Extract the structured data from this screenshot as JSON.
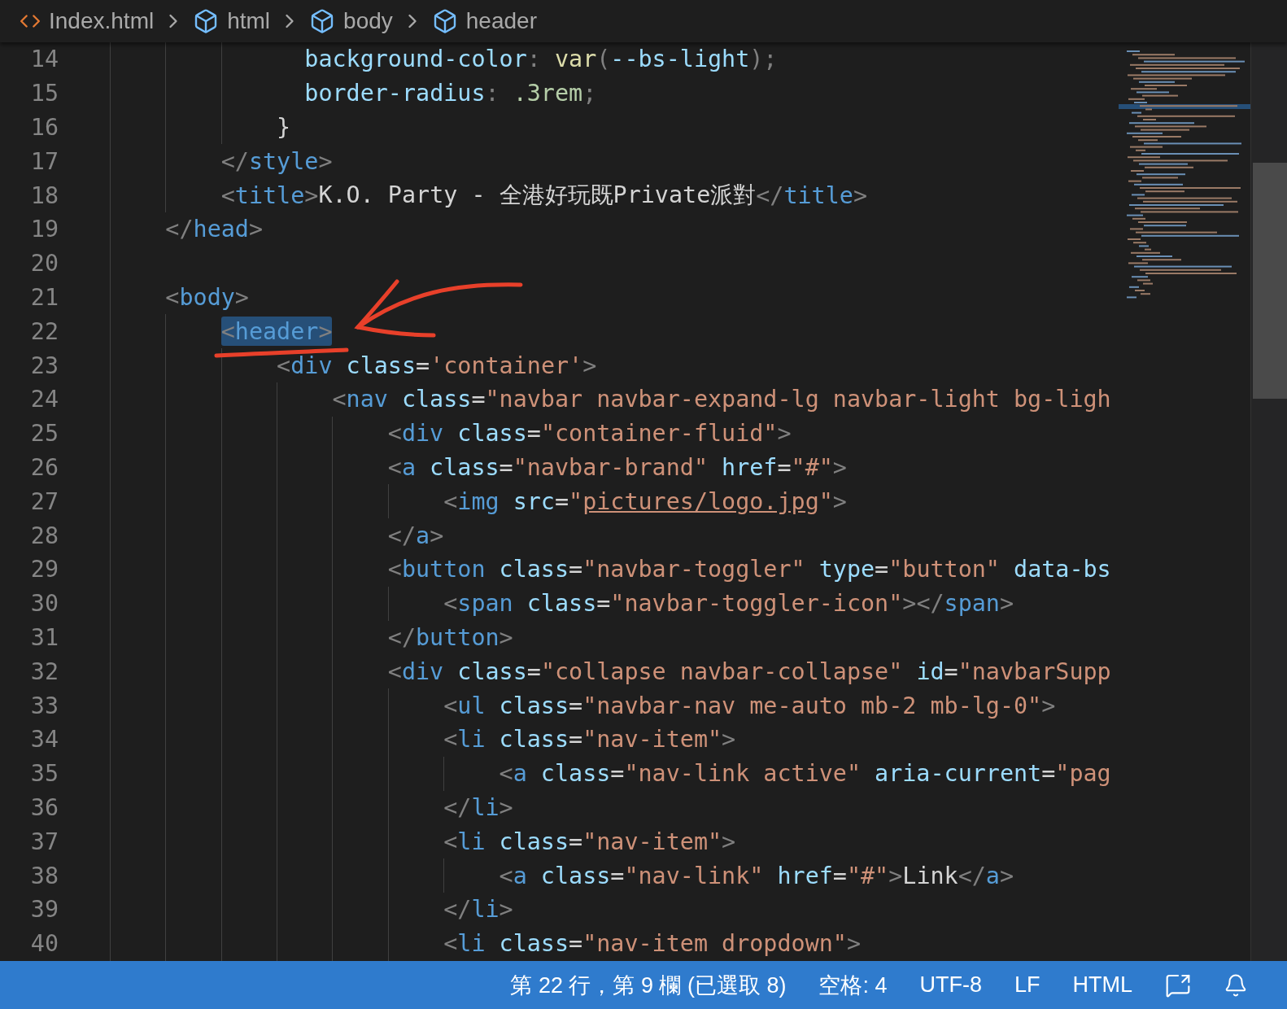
{
  "breadcrumb": [
    {
      "label": "Index.html",
      "kind": "file"
    },
    {
      "label": "html",
      "kind": "element"
    },
    {
      "label": "body",
      "kind": "element"
    },
    {
      "label": "header",
      "kind": "element"
    }
  ],
  "editor": {
    "lines": [
      {
        "children": [
          {
            "children": [
              {
                "children": [
                  {
                    "number": "14",
                    "selected": false,
                    "tokens": [
                      {
                        "kind": "attr",
                        "text": "  background-color"
                      },
                      {
                        "kind": "punct",
                        "text": ": "
                      },
                      {
                        "kind": "func",
                        "text": "var"
                      },
                      {
                        "kind": "punct",
                        "text": "("
                      },
                      {
                        "kind": "attr",
                        "text": "--bs-light"
                      },
                      {
                        "kind": "punct",
                        "text": ");"
                      }
                    ]
                  },
                  {
                    "number": "15",
                    "selected": false,
                    "tokens": [
                      {
                        "kind": "attr",
                        "text": "  border-radius"
                      },
                      {
                        "kind": "punct",
                        "text": ": "
                      },
                      {
                        "kind": "num",
                        "text": ".3rem"
                      },
                      {
                        "kind": "punct",
                        "text": ";"
                      }
                    ]
                  },
                  {
                    "number": "16",
                    "selected": false,
                    "tokens": [
                      {
                        "kind": "text",
                        "text": "}"
                      }
                    ]
                  }
                ]
              },
              {
                "number": "17",
                "selected": false,
                "tokens": [
                  {
                    "kind": "punct",
                    "text": "</"
                  },
                  {
                    "kind": "tag",
                    "text": "style"
                  },
                  {
                    "kind": "punct",
                    "text": ">"
                  }
                ]
              },
              {
                "number": "18",
                "selected": false,
                "tokens": [
                  {
                    "kind": "punct",
                    "text": "<"
                  },
                  {
                    "kind": "tag",
                    "text": "title"
                  },
                  {
                    "kind": "punct",
                    "text": ">"
                  },
                  {
                    "kind": "text",
                    "text": "K.O. Party - 全港好玩既Private派對"
                  },
                  {
                    "kind": "punct",
                    "text": "</"
                  },
                  {
                    "kind": "tag",
                    "text": "title"
                  },
                  {
                    "kind": "punct",
                    "text": ">"
                  }
                ]
              }
            ]
          },
          {
            "number": "19",
            "selected": false,
            "tokens": [
              {
                "kind": "punct",
                "text": "</"
              },
              {
                "kind": "tag",
                "text": "head"
              },
              {
                "kind": "punct",
                "text": ">"
              }
            ]
          },
          {
            "number": "20"
          },
          {
            "number": "21",
            "selected": false,
            "tokens": [
              {
                "kind": "punct",
                "text": "<"
              },
              {
                "kind": "tag",
                "text": "body"
              },
              {
                "kind": "punct",
                "text": ">"
              }
            ],
            "children": [
              {
                "number": "22",
                "selected": true,
                "tokens": [
                  {
                    "kind": "punct",
                    "text": "<"
                  },
                  {
                    "kind": "tag",
                    "text": "header"
                  },
                  {
                    "kind": "punct",
                    "text": ">"
                  }
                ],
                "children": [
                  {
                    "number": "23",
                    "selected": false,
                    "tokens": [
                      {
                        "kind": "punct",
                        "text": "<"
                      },
                      {
                        "kind": "tag",
                        "text": "div"
                      },
                      {
                        "kind": "attr",
                        "text": " class"
                      },
                      {
                        "kind": "text",
                        "text": "="
                      },
                      {
                        "kind": "string",
                        "text": "'container'"
                      },
                      {
                        "kind": "punct",
                        "text": ">"
                      }
                    ],
                    "children": [
                      {
                        "number": "24",
                        "selected": false,
                        "tokens": [
                          {
                            "kind": "punct",
                            "text": "<"
                          },
                          {
                            "kind": "tag",
                            "text": "nav"
                          },
                          {
                            "kind": "attr",
                            "text": " class"
                          },
                          {
                            "kind": "text",
                            "text": "="
                          },
                          {
                            "kind": "string",
                            "text": "\"navbar navbar-expand-lg navbar-light bg-ligh"
                          }
                        ],
                        "children": [
                          {
                            "number": "25",
                            "selected": false,
                            "tokens": [
                              {
                                "kind": "punct",
                                "text": "<"
                              },
                              {
                                "kind": "tag",
                                "text": "div"
                              },
                              {
                                "kind": "attr",
                                "text": " class"
                              },
                              {
                                "kind": "text",
                                "text": "="
                              },
                              {
                                "kind": "string",
                                "text": "\"container-fluid\""
                              },
                              {
                                "kind": "punct",
                                "text": ">"
                              }
                            ]
                          },
                          {
                            "number": "26",
                            "selected": false,
                            "tokens": [
                              {
                                "kind": "punct",
                                "text": "<"
                              },
                              {
                                "kind": "tag",
                                "text": "a"
                              },
                              {
                                "kind": "attr",
                                "text": " class"
                              },
                              {
                                "kind": "text",
                                "text": "="
                              },
                              {
                                "kind": "string",
                                "text": "\"navbar-brand\""
                              },
                              {
                                "kind": "attr",
                                "text": " href"
                              },
                              {
                                "kind": "text",
                                "text": "="
                              },
                              {
                                "kind": "string",
                                "text": "\"#\""
                              },
                              {
                                "kind": "punct",
                                "text": ">"
                              }
                            ],
                            "children": [
                              {
                                "number": "27",
                                "selected": false,
                                "tokens": [
                                  {
                                    "kind": "punct",
                                    "text": "<"
                                  },
                                  {
                                    "kind": "tag",
                                    "text": "img"
                                  },
                                  {
                                    "kind": "attr",
                                    "text": " src"
                                  },
                                  {
                                    "kind": "text",
                                    "text": "="
                                  },
                                  {
                                    "kind": "string",
                                    "text": "\""
                                  },
                                  {
                                    "kind": "link",
                                    "text": "pictures/logo.jpg"
                                  },
                                  {
                                    "kind": "string",
                                    "text": "\""
                                  },
                                  {
                                    "kind": "punct",
                                    "text": ">"
                                  }
                                ]
                              }
                            ]
                          },
                          {
                            "number": "28",
                            "selected": false,
                            "tokens": [
                              {
                                "kind": "punct",
                                "text": "</"
                              },
                              {
                                "kind": "tag",
                                "text": "a"
                              },
                              {
                                "kind": "punct",
                                "text": ">"
                              }
                            ]
                          },
                          {
                            "number": "29",
                            "selected": false,
                            "tokens": [
                              {
                                "kind": "punct",
                                "text": "<"
                              },
                              {
                                "kind": "tag",
                                "text": "button"
                              },
                              {
                                "kind": "attr",
                                "text": " class"
                              },
                              {
                                "kind": "text",
                                "text": "="
                              },
                              {
                                "kind": "string",
                                "text": "\"navbar-toggler\""
                              },
                              {
                                "kind": "attr",
                                "text": " type"
                              },
                              {
                                "kind": "text",
                                "text": "="
                              },
                              {
                                "kind": "string",
                                "text": "\"button\""
                              },
                              {
                                "kind": "attr",
                                "text": " data-bs"
                              }
                            ],
                            "children": [
                              {
                                "number": "30",
                                "selected": false,
                                "tokens": [
                                  {
                                    "kind": "punct",
                                    "text": "<"
                                  },
                                  {
                                    "kind": "tag",
                                    "text": "span"
                                  },
                                  {
                                    "kind": "attr",
                                    "text": " class"
                                  },
                                  {
                                    "kind": "text",
                                    "text": "="
                                  },
                                  {
                                    "kind": "string",
                                    "text": "\"navbar-toggler-icon\""
                                  },
                                  {
                                    "kind": "punct",
                                    "text": "></"
                                  },
                                  {
                                    "kind": "tag",
                                    "text": "span"
                                  },
                                  {
                                    "kind": "punct",
                                    "text": ">"
                                  }
                                ]
                              }
                            ]
                          },
                          {
                            "number": "31",
                            "selected": false,
                            "tokens": [
                              {
                                "kind": "punct",
                                "text": "</"
                              },
                              {
                                "kind": "tag",
                                "text": "button"
                              },
                              {
                                "kind": "punct",
                                "text": ">"
                              }
                            ]
                          },
                          {
                            "number": "32",
                            "selected": false,
                            "tokens": [
                              {
                                "kind": "punct",
                                "text": "<"
                              },
                              {
                                "kind": "tag",
                                "text": "div"
                              },
                              {
                                "kind": "attr",
                                "text": " class"
                              },
                              {
                                "kind": "text",
                                "text": "="
                              },
                              {
                                "kind": "string",
                                "text": "\"collapse navbar-collapse\""
                              },
                              {
                                "kind": "attr",
                                "text": " id"
                              },
                              {
                                "kind": "text",
                                "text": "="
                              },
                              {
                                "kind": "string",
                                "text": "\"navbarSupp"
                              }
                            ],
                            "children": [
                              {
                                "number": "33",
                                "selected": false,
                                "tokens": [
                                  {
                                    "kind": "punct",
                                    "text": "<"
                                  },
                                  {
                                    "kind": "tag",
                                    "text": "ul"
                                  },
                                  {
                                    "kind": "attr",
                                    "text": " class"
                                  },
                                  {
                                    "kind": "text",
                                    "text": "="
                                  },
                                  {
                                    "kind": "string",
                                    "text": "\"navbar-nav me-auto mb-2 mb-lg-0\""
                                  },
                                  {
                                    "kind": "punct",
                                    "text": ">"
                                  }
                                ]
                              },
                              {
                                "number": "34",
                                "selected": false,
                                "tokens": [
                                  {
                                    "kind": "punct",
                                    "text": "<"
                                  },
                                  {
                                    "kind": "tag",
                                    "text": "li"
                                  },
                                  {
                                    "kind": "attr",
                                    "text": " class"
                                  },
                                  {
                                    "kind": "text",
                                    "text": "="
                                  },
                                  {
                                    "kind": "string",
                                    "text": "\"nav-item\""
                                  },
                                  {
                                    "kind": "punct",
                                    "text": ">"
                                  }
                                ],
                                "children": [
                                  {
                                    "number": "35",
                                    "selected": false,
                                    "tokens": [
                                      {
                                        "kind": "punct",
                                        "text": "<"
                                      },
                                      {
                                        "kind": "tag",
                                        "text": "a"
                                      },
                                      {
                                        "kind": "attr",
                                        "text": " class"
                                      },
                                      {
                                        "kind": "text",
                                        "text": "="
                                      },
                                      {
                                        "kind": "string",
                                        "text": "\"nav-link active\""
                                      },
                                      {
                                        "kind": "attr",
                                        "text": " aria-current"
                                      },
                                      {
                                        "kind": "text",
                                        "text": "="
                                      },
                                      {
                                        "kind": "string",
                                        "text": "\"pag"
                                      }
                                    ]
                                  }
                                ]
                              },
                              {
                                "number": "36",
                                "selected": false,
                                "tokens": [
                                  {
                                    "kind": "punct",
                                    "text": "</"
                                  },
                                  {
                                    "kind": "tag",
                                    "text": "li"
                                  },
                                  {
                                    "kind": "punct",
                                    "text": ">"
                                  }
                                ]
                              },
                              {
                                "number": "37",
                                "selected": false,
                                "tokens": [
                                  {
                                    "kind": "punct",
                                    "text": "<"
                                  },
                                  {
                                    "kind": "tag",
                                    "text": "li"
                                  },
                                  {
                                    "kind": "attr",
                                    "text": " class"
                                  },
                                  {
                                    "kind": "text",
                                    "text": "="
                                  },
                                  {
                                    "kind": "string",
                                    "text": "\"nav-item\""
                                  },
                                  {
                                    "kind": "punct",
                                    "text": ">"
                                  }
                                ],
                                "children": [
                                  {
                                    "number": "38",
                                    "selected": false,
                                    "tokens": [
                                      {
                                        "kind": "punct",
                                        "text": "<"
                                      },
                                      {
                                        "kind": "tag",
                                        "text": "a"
                                      },
                                      {
                                        "kind": "attr",
                                        "text": " class"
                                      },
                                      {
                                        "kind": "text",
                                        "text": "="
                                      },
                                      {
                                        "kind": "string",
                                        "text": "\"nav-link\""
                                      },
                                      {
                                        "kind": "attr",
                                        "text": " href"
                                      },
                                      {
                                        "kind": "text",
                                        "text": "="
                                      },
                                      {
                                        "kind": "string",
                                        "text": "\"#\""
                                      },
                                      {
                                        "kind": "punct",
                                        "text": ">"
                                      },
                                      {
                                        "kind": "text",
                                        "text": "Link"
                                      },
                                      {
                                        "kind": "punct",
                                        "text": "</"
                                      },
                                      {
                                        "kind": "tag",
                                        "text": "a"
                                      },
                                      {
                                        "kind": "punct",
                                        "text": ">"
                                      }
                                    ]
                                  }
                                ]
                              },
                              {
                                "number": "39",
                                "selected": false,
                                "tokens": [
                                  {
                                    "kind": "punct",
                                    "text": "</"
                                  },
                                  {
                                    "kind": "tag",
                                    "text": "li"
                                  },
                                  {
                                    "kind": "punct",
                                    "text": ">"
                                  }
                                ]
                              },
                              {
                                "number": "40",
                                "selected": false,
                                "tokens": [
                                  {
                                    "kind": "punct",
                                    "text": "<"
                                  },
                                  {
                                    "kind": "tag",
                                    "text": "li"
                                  },
                                  {
                                    "kind": "attr",
                                    "text": " class"
                                  },
                                  {
                                    "kind": "text",
                                    "text": "="
                                  },
                                  {
                                    "kind": "string",
                                    "text": "\"nav-item dropdown\""
                                  },
                                  {
                                    "kind": "punct",
                                    "text": ">"
                                  }
                                ]
                              }
                            ]
                          }
                        ]
                      }
                    ]
                  }
                ]
              }
            ]
          }
        ]
      }
    ]
  },
  "status_bar": {
    "items": [
      {
        "kind": "text",
        "text": "第 22 行，第 9 欄 (已選取 8)"
      },
      {
        "kind": "text",
        "text": "空格: 4"
      },
      {
        "kind": "text",
        "text": "UTF-8"
      },
      {
        "kind": "text",
        "text": "LF"
      },
      {
        "kind": "text",
        "text": "HTML"
      },
      {
        "kind": "feedback"
      },
      {
        "kind": "bell"
      }
    ]
  }
}
